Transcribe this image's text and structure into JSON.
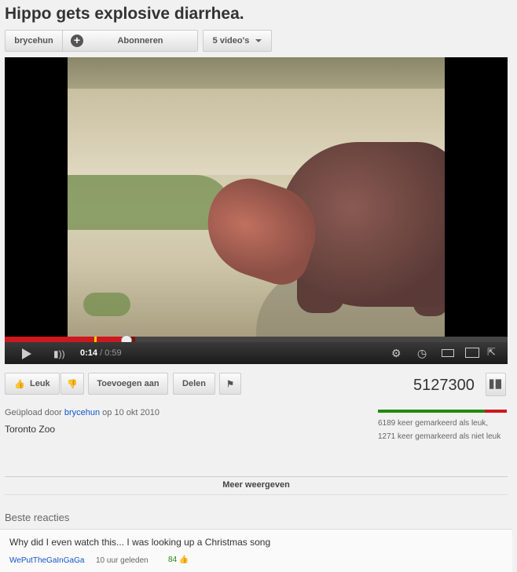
{
  "video": {
    "title": "Hippo gets explosive diarrhea.",
    "channel": "brycehun",
    "subscribe_label": "Abonneren",
    "videos_label": "5 video's",
    "current_time": "0:14",
    "duration": " / 0:59",
    "progress_fraction": 0.24,
    "loaded_fraction": 0.26
  },
  "actions": {
    "like_label": "Leuk",
    "add_label": "Toevoegen aan",
    "share_label": "Delen",
    "view_count": "5127300"
  },
  "info": {
    "uploaded_prefix": "Geüpload door ",
    "uploader": "brycehun",
    "uploaded_suffix": " op 10 okt 2010",
    "description": "Toronto Zoo",
    "likes_text": "6189 keer gemarkeerd als leuk, 1271 keer gemarkeerd als niet leuk",
    "like_fraction": 0.83,
    "more_label": "Meer weergeven"
  },
  "comments": {
    "heading": "Beste reacties",
    "items": [
      {
        "text": "Why did I even watch this... I was looking up a Christmas song",
        "author": "WePutTheGaInGaGa",
        "time": "10 uur geleden",
        "votes": "84"
      }
    ]
  },
  "colors": {
    "accent_red": "#cc181e",
    "like_green": "#238a0c",
    "link_blue": "#1155cc"
  },
  "icons": [
    "plus-icon",
    "chevron-down-icon",
    "play-icon",
    "volume-icon",
    "gear-icon",
    "clock-icon",
    "small-player-icon",
    "large-player-icon",
    "fullscreen-icon",
    "thumbs-up-icon",
    "thumbs-down-icon",
    "flag-icon",
    "stats-icon"
  ]
}
